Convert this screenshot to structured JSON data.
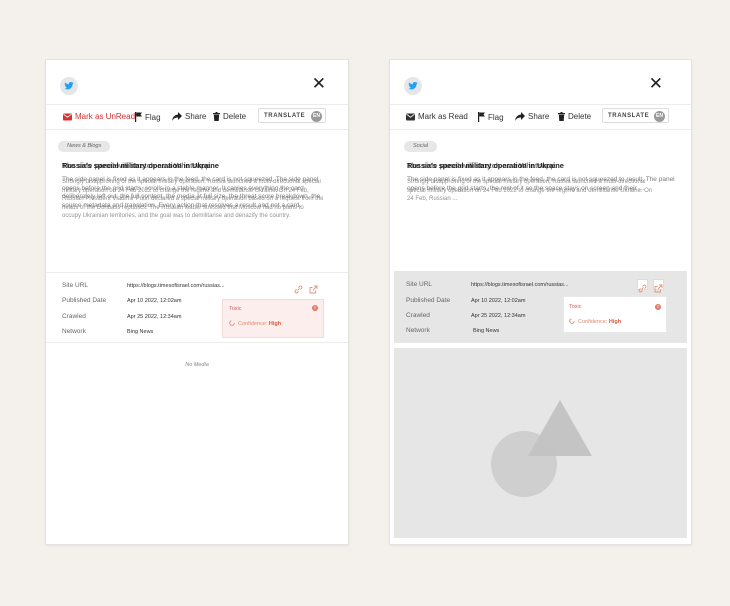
{
  "left": {
    "toolbar": {
      "mark": "Mark as UnRead",
      "flag": "Flag",
      "share": "Share",
      "delete": "Delete",
      "translate": "TRANSLATE",
      "lang": "EN"
    },
    "category": "News & Blogs",
    "title": "Russia's special military operation in Ukraine",
    "title_overlay": "The side panel will stretch as a Whatsapp.",
    "body_overlay": "The side panel is fixed as it appears in the feed, the card is not squeezed. The side panel opens before the grid starts, scrolls in a stable manner. It carries everything the card deliberately left out, the full content, the media at full size, the threat score breakdown, the source metadata and translation. Every action that resolves a result and not a card.",
    "body": "Strongly disapproving of the special military operation, Russia launched a multi-directional special military operation on 24 Feb 2022 to change the regime and demilitarise Ukraine. On 24 Feb, Russian President Vladimir Putin declared a special military operation based on a request from the heads of the Donbass republics. The Russian leader stressed that Moscow had no plans to occupy Ukrainian territories, and the goal was to demilitarise and denazify the country.",
    "meta": {
      "site_url_label": "Site URL",
      "site_url": "https://blogs.timesofisrael.com/russias...",
      "published_label": "Published Date",
      "published": "Apr 10 2022, 12:02am",
      "crawled_label": "Crawled",
      "crawled": "Apr 25 2022, 12:34am",
      "network_label": "Network",
      "network": "Bing News"
    },
    "toxicity": {
      "label": "Toxic",
      "confidence_label": "Confidence:",
      "confidence_value": "High"
    },
    "no_media": "No Media"
  },
  "right": {
    "toolbar": {
      "mark": "Mark as Read",
      "flag": "Flag",
      "share": "Share",
      "delete": "Delete",
      "translate": "TRANSLATE",
      "lang": "EN"
    },
    "category": "Social",
    "title": "Russia's special military operation in Ukraine",
    "title_overlay": "The side panel will stretch as a Whatsapp.",
    "body_overlay": "The side panel is fixed as it appears in the feed, the card is not squeezed to result. The panel opens before the grid starts, the rest of it so the space stays on screen and their ...",
    "body": "Strongly disapproving of the special military operation, Russia launched a multi-directional special military operation on 24 Feb 2022 to change the regime and demilitarise Ukraine. On 24 Feb, Russian ...",
    "meta": {
      "site_url_label": "Site URL",
      "site_url": "https://blogs.timesofisrael.com/russias...",
      "published_label": "Published Date",
      "published": "Apr 10 2022, 12:02am",
      "crawled_label": "Crawled",
      "crawled": "Apr 25 2022, 12:34am",
      "network_label": "Network",
      "network": "Bing News"
    },
    "toxicity": {
      "label": "Toxic",
      "confidence_label": "Confidence:",
      "confidence_value": "High"
    }
  },
  "colors": {
    "accent_red": "#d93030",
    "toxic_bg": "#fdeeee",
    "twitter": "#1da1f2"
  }
}
